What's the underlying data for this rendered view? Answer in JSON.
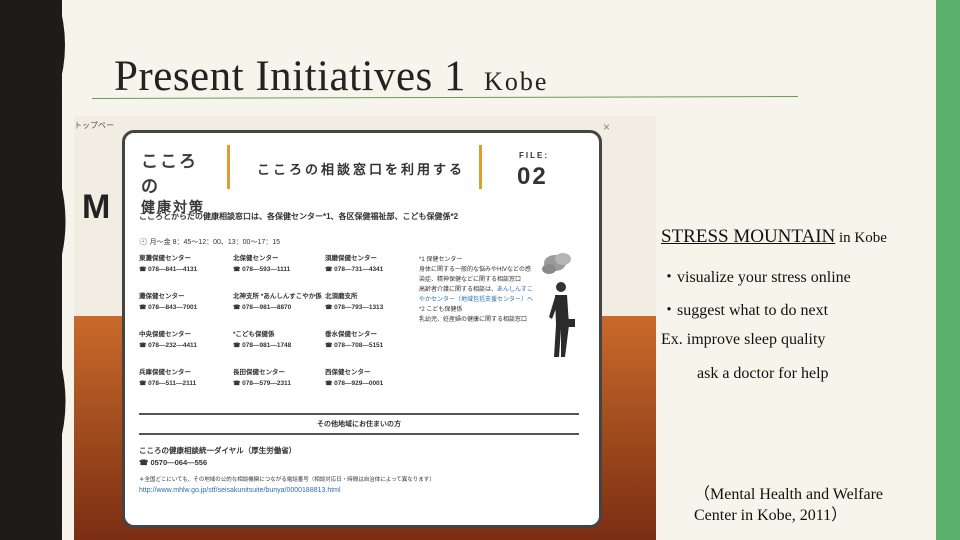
{
  "slide": {
    "title": "Present Initiatives 1",
    "subtitle": "Kobe",
    "colors": {
      "left_band": "#1e1b19",
      "right_band": "#5ab06b",
      "background": "#f7f4ec"
    },
    "right": {
      "stress_mountain": "STRESS MOUNTAIN",
      "in_kobe": " in Kobe",
      "bullet1": "・visualize your stress online",
      "bullet2": "・suggest what to do next",
      "ex1": "Ex. improve sleep quality",
      "ex2": "ask a doctor for help",
      "citation1": "（Mental Health and Welfare",
      "citation2": "Center in Kobe, 2011）"
    }
  },
  "screenshot": {
    "bg_tab": "トップペー",
    "bg_letter": "M",
    "bg_close": "×",
    "card": {
      "logo_line1": "こころの",
      "logo_line2": "健康対策",
      "heading": "こころの相談窓口を利用する",
      "file_label": "FILE:",
      "file_number": "02",
      "intro": "こころとからだの健康相談窓口は、各保健センター*1、各区保健福祉部、こども保健係*2",
      "hours": "月〜金 8：45〜12：00、13：00〜17：15",
      "centers": [
        {
          "name": "東灘保健センター",
          "phone": "078—841—4131"
        },
        {
          "name": "灘保健センター",
          "phone": "078—843—7001"
        },
        {
          "name": "中央保健センター",
          "phone": "078—232—4411"
        },
        {
          "name": "兵庫保健センター",
          "phone": "078—511—2111"
        },
        {
          "name": "北保健センター",
          "phone": "078—593—1111"
        },
        {
          "name": "北神支所 *あんしんすこやか係",
          "phone": "078—981—8870"
        },
        {
          "name": "*こども保健係",
          "phone": "078—981—1748"
        },
        {
          "name": "長田保健センター",
          "phone": "078—579—2311"
        },
        {
          "name": "須磨保健センター",
          "phone": "078—731—4341"
        },
        {
          "name": "北須磨支所",
          "phone": "078—793—1313"
        },
        {
          "name": "垂水保健センター",
          "phone": "078—708—5151"
        },
        {
          "name": "西保健センター",
          "phone": "078—929—0001"
        }
      ],
      "note1_title": "*1 保健センター",
      "note1_body": "身体に関する一般的な悩みやHIVなどの感染症、精神保健などに関する相談窓口",
      "note1_link_pre": "高齢者介護に関する相談は、",
      "note1_link": "あんしんすこやかセンター（地域包括支援センター）へ",
      "note2_title": "*2 こども保健係",
      "note2_body": "乳幼児、妊産婦の健康に関する相談窓口",
      "other_areas": "その他地域にお住まいの方",
      "helpline_name": "こころの健康相談統一ダイヤル（厚生労働省）",
      "helpline_phone": "0570—064—556",
      "footnote": "＊全国どこにいても、その地域の公的な相談機関につながる電話番号（相談対応日・時間は自治体によって異なります）",
      "url": "http://www.mhlw.go.jp/stf/seisakunitsuite/bunya/0000188813.html"
    }
  }
}
